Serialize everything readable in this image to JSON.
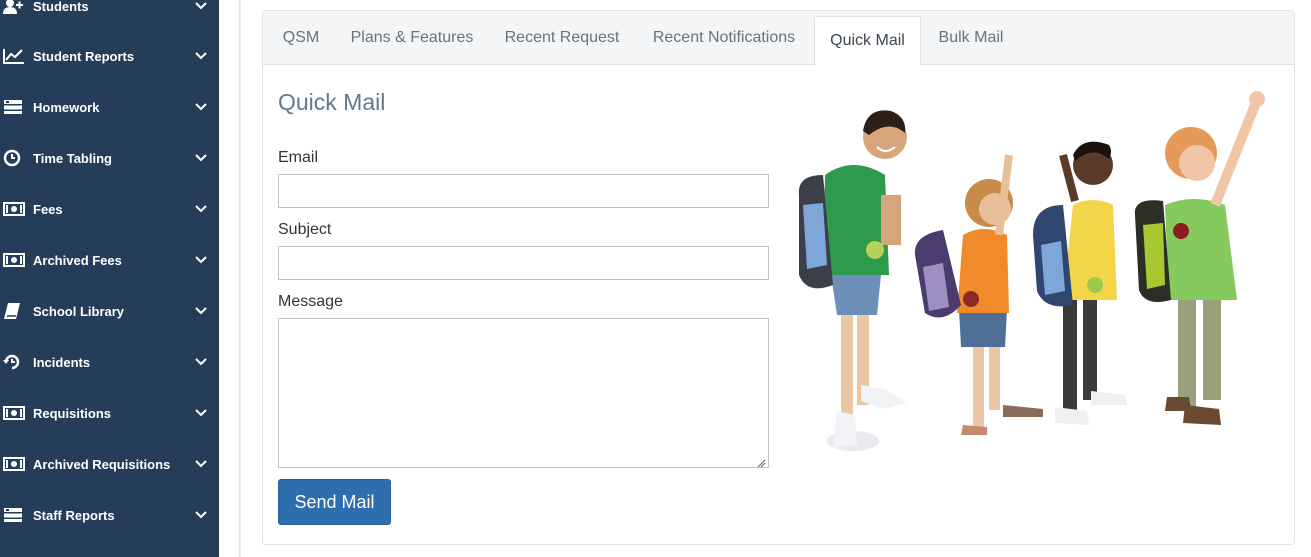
{
  "sidebar": {
    "items": [
      {
        "label": "Students",
        "icon": "user-plus-icon"
      },
      {
        "label": "Student Reports",
        "icon": "line-chart-icon"
      },
      {
        "label": "Homework",
        "icon": "tasks-icon"
      },
      {
        "label": "Time Tabling",
        "icon": "clock-icon"
      },
      {
        "label": "Fees",
        "icon": "money-icon"
      },
      {
        "label": "Archived Fees",
        "icon": "money-icon"
      },
      {
        "label": "School Library",
        "icon": "book-icon"
      },
      {
        "label": "Incidents",
        "icon": "history-icon"
      },
      {
        "label": "Requisitions",
        "icon": "money-icon"
      },
      {
        "label": "Archived Requisitions",
        "icon": "money-icon"
      },
      {
        "label": "Staff Reports",
        "icon": "tasks-icon"
      }
    ]
  },
  "tabs": [
    {
      "label": "QSM"
    },
    {
      "label": "Plans & Features"
    },
    {
      "label": "Recent Request"
    },
    {
      "label": "Recent Notifications"
    },
    {
      "label": "Quick Mail",
      "active": true
    },
    {
      "label": "Bulk Mail"
    }
  ],
  "form": {
    "title": "Quick Mail",
    "email_label": "Email",
    "email_value": "",
    "subject_label": "Subject",
    "subject_value": "",
    "message_label": "Message",
    "message_value": "",
    "send_label": "Send Mail"
  },
  "colors": {
    "sidebar_bg": "#263d5a",
    "heading": "#61798f",
    "button": "#2f6eae"
  }
}
